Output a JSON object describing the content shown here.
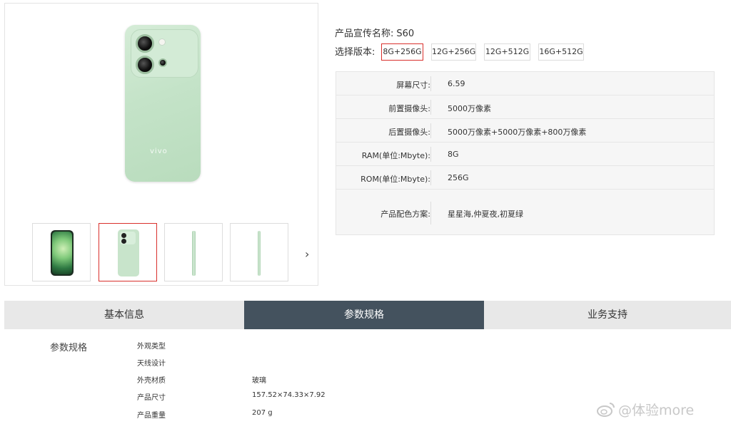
{
  "product": {
    "name_label": "产品宣传名称:",
    "name_value": "S60",
    "version_label": "选择版本:",
    "brand_mark": "vivo"
  },
  "versions": [
    {
      "label": "8G+256G",
      "selected": true
    },
    {
      "label": "12G+256G",
      "selected": false
    },
    {
      "label": "12G+512G",
      "selected": false
    },
    {
      "label": "16G+512G",
      "selected": false
    }
  ],
  "gallery": {
    "thumbnails": [
      "front",
      "back",
      "side",
      "side-thin"
    ],
    "selected_index": 1,
    "next_arrow": "›"
  },
  "specs": [
    {
      "key": "屏幕尺寸:",
      "value": "6.59"
    },
    {
      "key": "前置摄像头:",
      "value": "5000万像素"
    },
    {
      "key": "后置摄像头:",
      "value": "5000万像素+5000万像素+800万像素"
    },
    {
      "key": "RAM(单位:Mbyte):",
      "value": "8G"
    },
    {
      "key": "ROM(单位:Mbyte):",
      "value": "256G"
    },
    {
      "key": "产品配色方案:",
      "value": "星星海,仲夏夜,初夏绿"
    }
  ],
  "tabs": [
    {
      "label": "基本信息",
      "active": false
    },
    {
      "label": "参数规格",
      "active": true
    },
    {
      "label": "业务支持",
      "active": false
    }
  ],
  "detail": {
    "title": "参数规格",
    "rows": [
      {
        "label": "外观类型",
        "value": ""
      },
      {
        "label": "天线设计",
        "value": ""
      },
      {
        "label": "外壳材质",
        "value": "玻璃"
      },
      {
        "label": "产品尺寸",
        "value": "157.52×74.33×7.92"
      },
      {
        "label": "产品重量",
        "value": "207 g"
      }
    ]
  },
  "watermark": "@体验more",
  "colors": {
    "accent_red": "#d9302c",
    "tab_active": "#44525e",
    "tab_bg": "#e8e8e8"
  }
}
